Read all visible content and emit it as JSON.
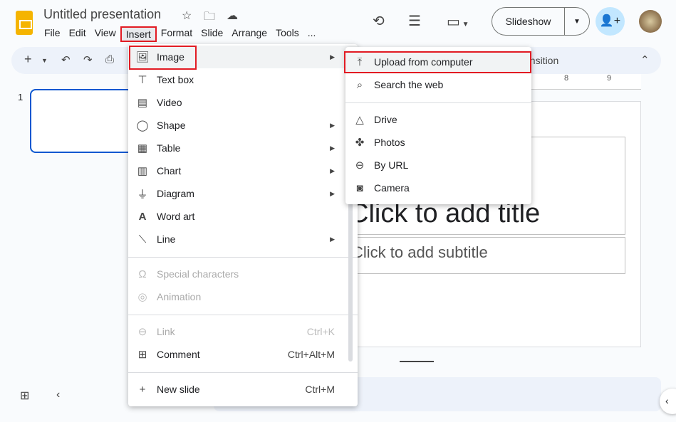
{
  "doc": {
    "title": "Untitled presentation"
  },
  "menubar": [
    "File",
    "Edit",
    "View",
    "Insert",
    "Format",
    "Slide",
    "Arrange",
    "Tools",
    "..."
  ],
  "header": {
    "slideshow": "Slideshow"
  },
  "toolbar": {
    "transition": "ansition"
  },
  "ruler": {
    "t8": "8",
    "t9": "9"
  },
  "filmstrip": {
    "slide_number": "1"
  },
  "slide": {
    "title_placeholder": "Click to add title",
    "subtitle_placeholder": "Click to add subtitle"
  },
  "insert_menu": {
    "items": [
      {
        "label": "Image",
        "icon": "image-icon",
        "submenu": true
      },
      {
        "label": "Text box",
        "icon": "text-box-icon"
      },
      {
        "label": "Video",
        "icon": "video-icon"
      },
      {
        "label": "Shape",
        "icon": "shape-icon",
        "submenu": true
      },
      {
        "label": "Table",
        "icon": "table-icon",
        "submenu": true
      },
      {
        "label": "Chart",
        "icon": "chart-icon",
        "submenu": true
      },
      {
        "label": "Diagram",
        "icon": "diagram-icon",
        "submenu": true
      },
      {
        "label": "Word art",
        "icon": "word-art-icon"
      },
      {
        "label": "Line",
        "icon": "line-icon",
        "submenu": true
      },
      {
        "label": "Special characters",
        "icon": "omega-icon",
        "disabled": true
      },
      {
        "label": "Animation",
        "icon": "animation-icon",
        "disabled": true
      },
      {
        "label": "Link",
        "icon": "link-icon",
        "shortcut": "Ctrl+K",
        "disabled": true
      },
      {
        "label": "Comment",
        "icon": "comment-icon",
        "shortcut": "Ctrl+Alt+M"
      },
      {
        "label": "New slide",
        "icon": "plus-icon",
        "shortcut": "Ctrl+M"
      }
    ]
  },
  "image_submenu": {
    "items": [
      {
        "label": "Upload from computer",
        "icon": "upload-icon"
      },
      {
        "label": "Search the web",
        "icon": "search-icon"
      },
      {
        "label": "Drive",
        "icon": "drive-icon"
      },
      {
        "label": "Photos",
        "icon": "photos-icon"
      },
      {
        "label": "By URL",
        "icon": "link-icon"
      },
      {
        "label": "Camera",
        "icon": "camera-icon"
      }
    ]
  },
  "colors": {
    "highlight": "#e21b23",
    "accent": "#0b57d0",
    "logo": "#f5b400"
  }
}
